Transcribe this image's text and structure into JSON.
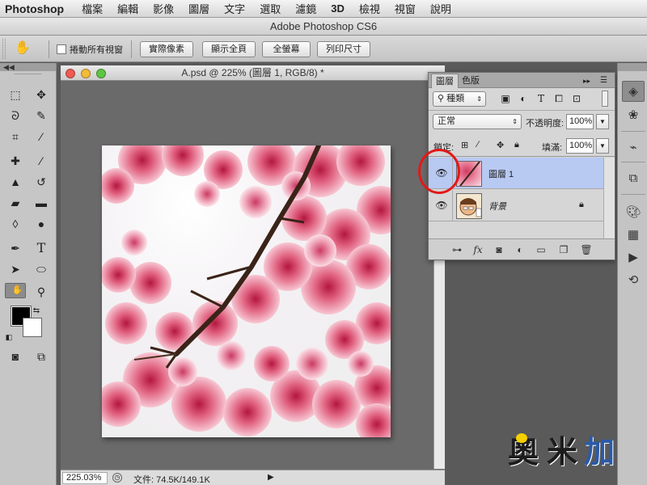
{
  "menubar": {
    "app": "Photoshop",
    "items": [
      "檔案",
      "編輯",
      "影像",
      "圖層",
      "文字",
      "選取",
      "濾鏡",
      "3D",
      "檢視",
      "視窗",
      "說明"
    ]
  },
  "window": {
    "title": "Adobe Photoshop CS6"
  },
  "options": {
    "tool_icon": "hand-icon",
    "checkbox_label": "捲動所有視窗",
    "buttons": [
      "實際像素",
      "顯示全頁",
      "全螢幕",
      "列印尺寸"
    ]
  },
  "toolbar": {
    "collapse": "◀◀",
    "tools": [
      "rectangular-marquee-icon",
      "move-icon",
      "lasso-icon",
      "quick-selection-icon",
      "crop-icon",
      "eyedropper-icon",
      "spot-healing-icon",
      "brush-icon",
      "clone-stamp-icon",
      "history-brush-icon",
      "eraser-icon",
      "gradient-icon",
      "blur-icon",
      "dodge-icon",
      "pen-icon",
      "type-icon",
      "path-selection-icon",
      "ellipse-icon",
      "hand-icon",
      "zoom-icon"
    ],
    "foreground_color": "#000000",
    "background_color": "#ffffff"
  },
  "document": {
    "title": "A.psd @ 225% (圖層 1, RGB/8) *",
    "zoom": "225.03%",
    "info": "文件: 74.5K/149.1K"
  },
  "layers_panel": {
    "tabs": [
      "圖層",
      "色版"
    ],
    "filter_label": "種類",
    "blend_mode": "正常",
    "opacity_label": "不透明度:",
    "opacity": "100%",
    "lock_label": "鎖定:",
    "fill_label": "填滿:",
    "fill": "100%",
    "layers": [
      {
        "name": "圖層 1",
        "visible": true,
        "selected": true,
        "locked": false
      },
      {
        "name": "背景",
        "visible": true,
        "selected": false,
        "locked": true
      }
    ],
    "bottom_icons": [
      "link-icon",
      "fx-icon",
      "mask-icon",
      "adjustment-icon",
      "group-icon",
      "new-layer-icon",
      "trash-icon"
    ]
  },
  "dock": {
    "icons": [
      "layers-icon",
      "color-wheel-icon",
      "paths-icon",
      "3d-icon",
      "palette-icon",
      "swatches-icon",
      "play-icon",
      "history-icon"
    ]
  },
  "watermark": {
    "text1": "奧",
    "text2": "米",
    "text3": "加"
  },
  "colors": {
    "highlight": "#b8c9f2",
    "annotation": "#e31818",
    "watermark_blue": "#2a5aa8"
  }
}
